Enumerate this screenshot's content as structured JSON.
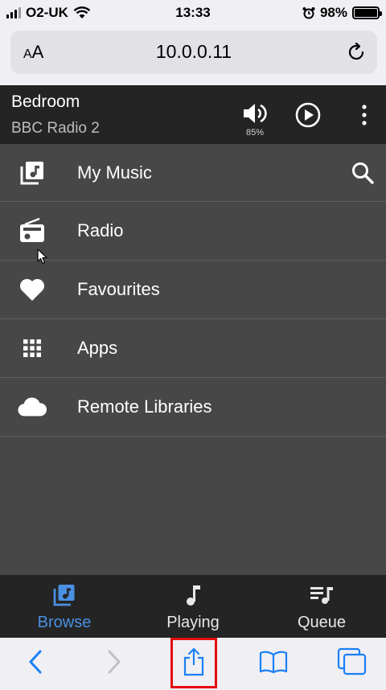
{
  "status_bar": {
    "carrier": "O2-UK",
    "time": "13:33",
    "battery": "98%"
  },
  "browser": {
    "text_size_label": "AA",
    "url": "10.0.0.11"
  },
  "player": {
    "room": "Bedroom",
    "station": "BBC Radio 2",
    "volume": "85%"
  },
  "browse": {
    "items": [
      {
        "label": "My Music",
        "icon": "music-library-icon"
      },
      {
        "label": "Radio",
        "icon": "radio-icon"
      },
      {
        "label": "Favourites",
        "icon": "heart-icon"
      },
      {
        "label": "Apps",
        "icon": "apps-grid-icon"
      },
      {
        "label": "Remote Libraries",
        "icon": "cloud-icon"
      }
    ]
  },
  "tabs": [
    {
      "label": "Browse",
      "icon": "music-library-icon",
      "active": true
    },
    {
      "label": "Playing",
      "icon": "music-note-icon",
      "active": false
    },
    {
      "label": "Queue",
      "icon": "queue-icon",
      "active": false
    }
  ],
  "colors": {
    "accent": "#4a90e2",
    "header_bg": "#242424",
    "list_bg": "#474747",
    "ios_blue": "#1a7ff5",
    "highlight": "#e30d0d"
  }
}
